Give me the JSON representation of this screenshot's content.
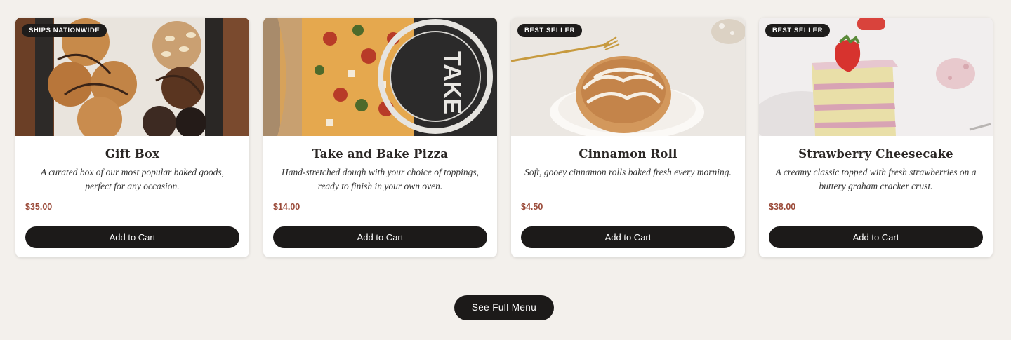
{
  "products": [
    {
      "badge": "SHIPS NATIONWIDE",
      "title": "Gift Box",
      "description": "A curated box of our most popular baked goods, perfect for any occasion.",
      "price": "$35.00",
      "button": "Add to Cart",
      "image": "cookies-gift-box-photo"
    },
    {
      "badge": "",
      "title": "Take and Bake Pizza",
      "description": "Hand-stretched dough with your choice of toppings, ready to finish in your own oven.",
      "price": "$14.00",
      "button": "Add to Cart",
      "image": "pizza-photo",
      "image_text": "TAKE"
    },
    {
      "badge": "BEST SELLER",
      "title": "Cinnamon Roll",
      "description": "Soft, gooey cinnamon rolls baked fresh every morning.",
      "price": "$4.50",
      "button": "Add to Cart",
      "image": "cinnamon-roll-photo"
    },
    {
      "badge": "BEST SELLER",
      "title": "Strawberry Cheesecake",
      "description": "A creamy classic topped with fresh strawberries on a buttery graham cracker crust.",
      "price": "$38.00",
      "button": "Add to Cart",
      "image": "strawberry-cake-photo"
    }
  ],
  "see_full_menu": "See Full Menu",
  "colors": {
    "background": "#f3f0ec",
    "button": "#1c1a19",
    "price": "#9b4b3a"
  }
}
